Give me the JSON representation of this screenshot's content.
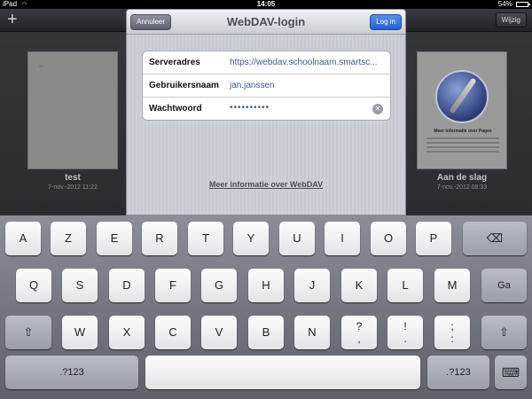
{
  "status": {
    "carrier": "iPad",
    "time": "14:05",
    "battery": "54%",
    "battery_level": 0.54
  },
  "app": {
    "edit_label": "Wijzig",
    "add_icon": "+"
  },
  "documents": [
    {
      "name": "test",
      "date": "7-nov.-2012 11:22"
    },
    {
      "name": "Aan de slag",
      "date": "7-nov.-2012 08:33",
      "preview_caption": "Meer informatie over Pages"
    }
  ],
  "dialog": {
    "title": "WebDAV-login",
    "cancel_label": "Annuleer",
    "login_label": "Log in",
    "fields": [
      {
        "label": "Serveradres",
        "value": "https://webdav.schoolnaam.smartsc..."
      },
      {
        "label": "Gebruikersnaam",
        "value": "jan.janssen"
      },
      {
        "label": "Wachtwoord",
        "value": "••••••••••"
      }
    ],
    "more_info_link": "Meer informatie over WebDAV"
  },
  "keyboard": {
    "row1": [
      "A",
      "Z",
      "E",
      "R",
      "T",
      "Y",
      "U",
      "I",
      "O",
      "P"
    ],
    "row2": [
      "Q",
      "S",
      "D",
      "F",
      "G",
      "H",
      "J",
      "K",
      "L",
      "M",
      "Ga"
    ],
    "row3": [
      "W",
      "X",
      "C",
      "V",
      "B",
      "N"
    ],
    "row3_punct": [
      "?",
      ",",
      "!",
      ".",
      ";",
      ":"
    ],
    "numbers_label": ".?123",
    "numbers_label_right": ".?123"
  }
}
